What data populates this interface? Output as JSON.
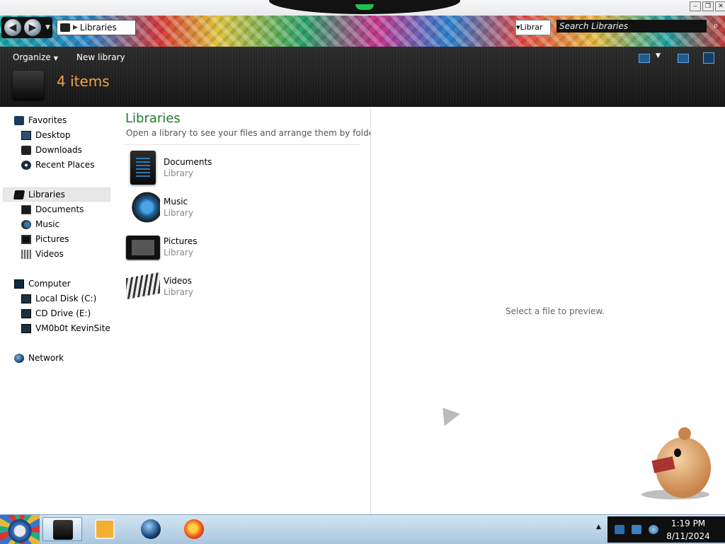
{
  "window": {
    "address_crumb": "Libraries",
    "address_dropdown_text": "Librar",
    "search_placeholder": "Search Libraries",
    "controls": [
      "minimize",
      "maximize",
      "close"
    ]
  },
  "toolbar": {
    "organize_label": "Organize",
    "new_library_label": "New library",
    "item_count": "4 items"
  },
  "nav": {
    "favorites": {
      "label": "Favorites",
      "items": [
        {
          "label": "Desktop",
          "icon": "desktop-icon"
        },
        {
          "label": "Downloads",
          "icon": "downloads-icon"
        },
        {
          "label": "Recent Places",
          "icon": "recent-places-icon"
        }
      ]
    },
    "libraries": {
      "label": "Libraries",
      "items": [
        {
          "label": "Documents",
          "icon": "documents-icon"
        },
        {
          "label": "Music",
          "icon": "music-icon"
        },
        {
          "label": "Pictures",
          "icon": "pictures-icon"
        },
        {
          "label": "Videos",
          "icon": "videos-icon"
        }
      ]
    },
    "computer": {
      "label": "Computer",
      "items": [
        {
          "label": "Local Disk (C:)",
          "icon": "disk-icon"
        },
        {
          "label": "CD Drive (E:)",
          "icon": "cd-drive-icon"
        },
        {
          "label": "VM0b0t KevinSite",
          "icon": "network-drive-icon"
        }
      ]
    },
    "network": {
      "label": "Network",
      "icon": "network-icon"
    }
  },
  "content": {
    "title": "Libraries",
    "subtitle": "Open a library to see your files and arrange them by folder...",
    "libraries": [
      {
        "name": "Documents",
        "type": "Library"
      },
      {
        "name": "Music",
        "type": "Library"
      },
      {
        "name": "Pictures",
        "type": "Library"
      },
      {
        "name": "Videos",
        "type": "Library"
      }
    ]
  },
  "preview": {
    "message": "Select a file to preview."
  },
  "taskbar": {
    "apps": [
      "windows-explorer",
      "media-player",
      "globe-browser",
      "firefox"
    ],
    "time": "1:19 PM",
    "date": "8/11/2024"
  }
}
